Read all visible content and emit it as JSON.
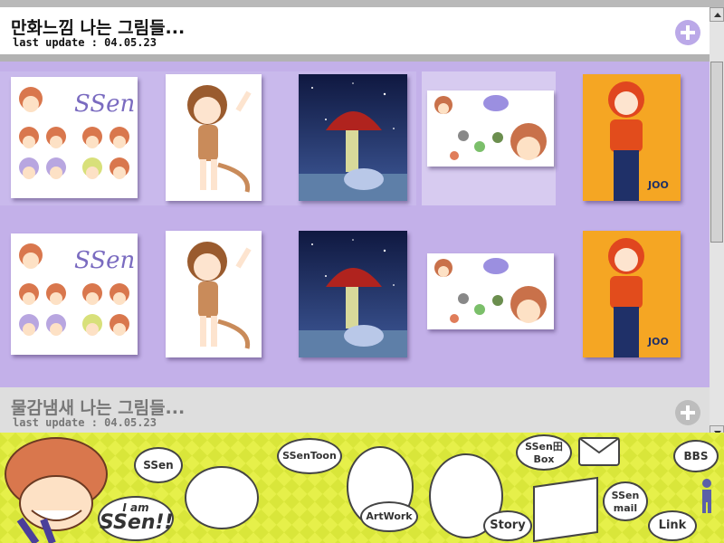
{
  "sections": [
    {
      "title": "만화느낌 나는 그림들...",
      "update": "last update : 04.05.23"
    },
    {
      "title": "물감냄새 나는 그림들...",
      "update": "last update : 04.05.23"
    }
  ],
  "footer": {
    "badge_line1": "I am",
    "badge_line2": "SSen!!",
    "nav_ssen": "SSen",
    "nav_ssentoon": "SSenToon",
    "nav_artwork": "ArtWork",
    "nav_story": "Story",
    "nav_box_line1": "SSen田",
    "nav_box_line2": "Box",
    "nav_mail_line1": "SSen",
    "nav_mail_line2": "mail",
    "nav_link": "Link",
    "nav_bbs": "BBS"
  },
  "colors": {
    "gallery_bg": "#c3b0e9",
    "accent_plus": "#bba9e8",
    "footer_bg": "#e8f24a"
  },
  "icons": [
    "plus-circle-icon",
    "scroll-up-arrow-icon",
    "scroll-down-arrow-icon",
    "person-icon"
  ]
}
